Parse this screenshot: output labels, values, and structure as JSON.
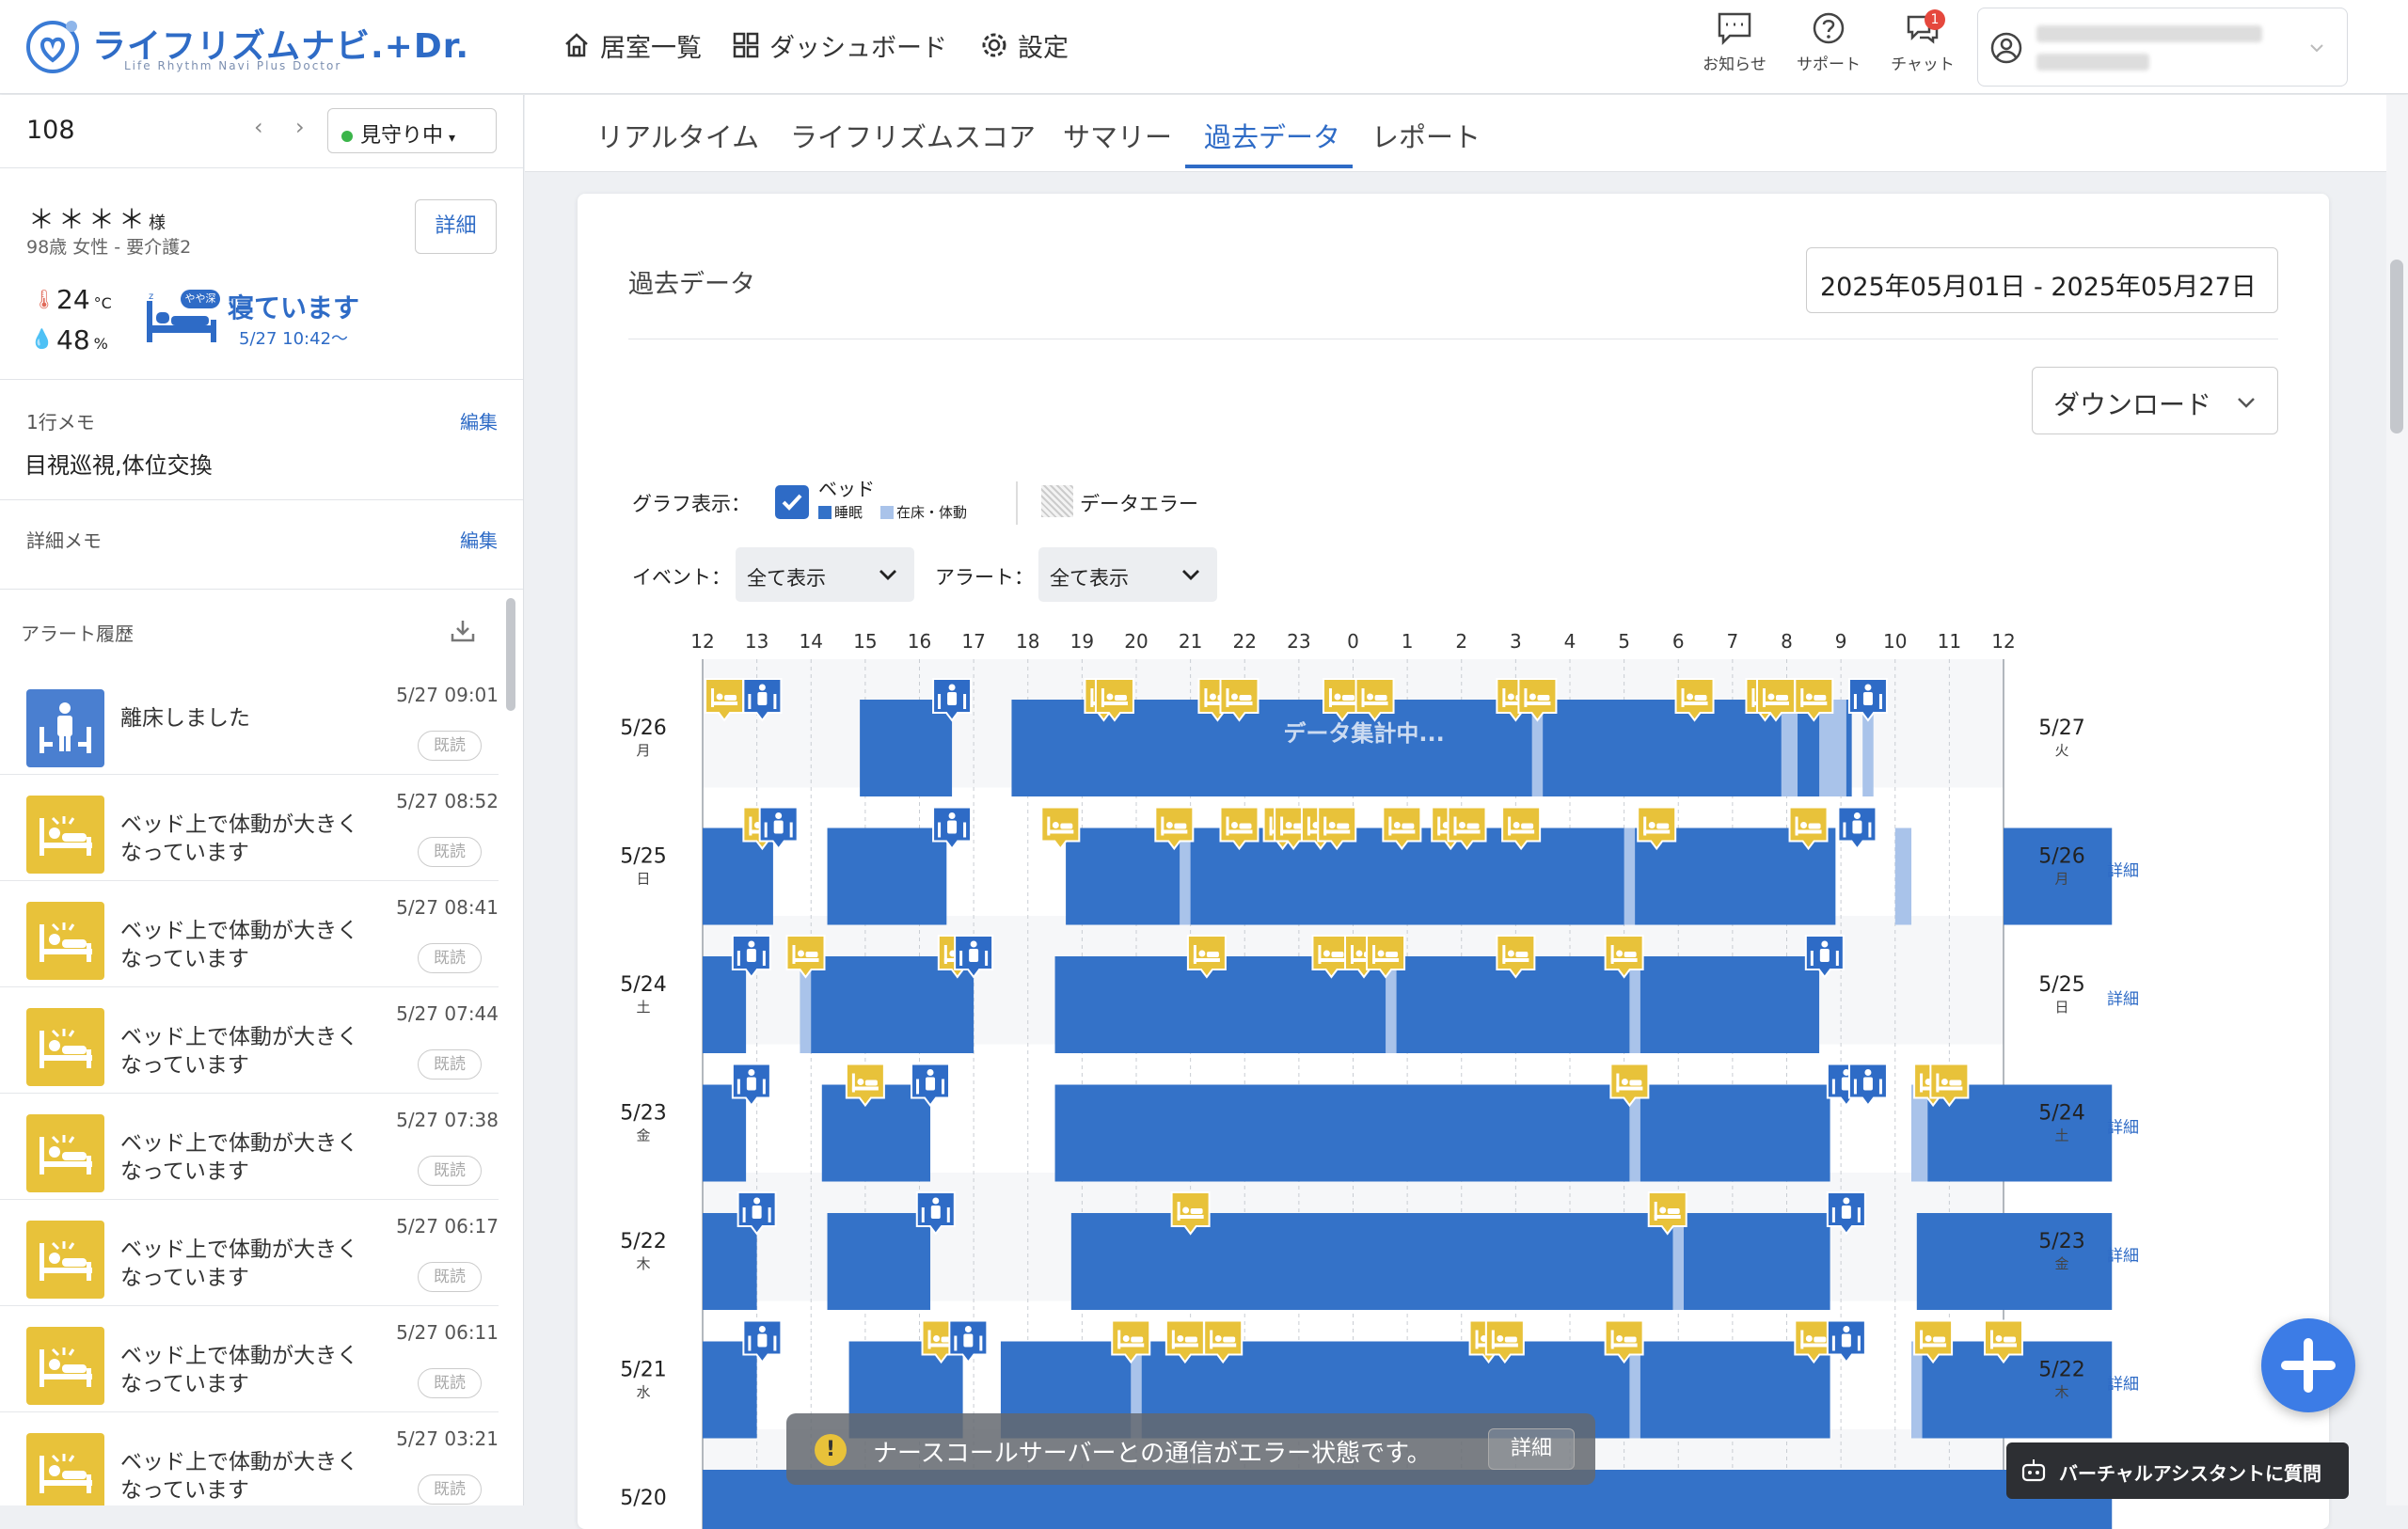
{
  "header": {
    "logo_text": "ライフリズムナビ.+Dr.",
    "logo_sub": "Life Rhythm Navi Plus Doctor",
    "nav": [
      {
        "label": "居室一覧",
        "icon": "home-icon"
      },
      {
        "label": "ダッシュボード",
        "icon": "dashboard-icon"
      },
      {
        "label": "設定",
        "icon": "gear-icon"
      }
    ],
    "icons": [
      {
        "label": "お知らせ",
        "icon": "notice-icon"
      },
      {
        "label": "サポート",
        "icon": "help-icon"
      },
      {
        "label": "チャット",
        "icon": "chat-icon",
        "badge": "1"
      }
    ]
  },
  "room": {
    "number": "108",
    "status": "見守り中",
    "name": "＊＊＊＊",
    "honorific": "様",
    "info": "98歳 女性 - 要介護2",
    "detail": "詳細",
    "temp": "24",
    "temp_unit": "°C",
    "humidity": "48",
    "humidity_unit": "%",
    "state": "寝ています",
    "state_badge": "やや深",
    "state_time": "5/27 10:42〜"
  },
  "memo": {
    "line_label": "1行メモ",
    "edit": "編集",
    "line_text": "目視巡視,体位交換",
    "detail_label": "詳細メモ"
  },
  "alerts": {
    "title": "アラート履歴",
    "read": "既読",
    "items": [
      {
        "text": "離床しました",
        "time": "5/27 09:01",
        "type": "exit"
      },
      {
        "text": "ベッド上で体動が大きくなっています",
        "time": "5/27 08:52",
        "type": "move"
      },
      {
        "text": "ベッド上で体動が大きくなっています",
        "time": "5/27 08:41",
        "type": "move"
      },
      {
        "text": "ベッド上で体動が大きくなっています",
        "time": "5/27 07:44",
        "type": "move"
      },
      {
        "text": "ベッド上で体動が大きくなっています",
        "time": "5/27 07:38",
        "type": "move"
      },
      {
        "text": "ベッド上で体動が大きくなっています",
        "time": "5/27 06:17",
        "type": "move"
      },
      {
        "text": "ベッド上で体動が大きくなっています",
        "time": "5/27 06:11",
        "type": "move"
      },
      {
        "text": "ベッド上で体動が大きくなっています",
        "time": "5/27 03:21",
        "type": "move"
      }
    ]
  },
  "tabs": [
    "リアルタイム",
    "ライフリズムスコア",
    "サマリー",
    "過去データ",
    "レポート"
  ],
  "active_tab": 3,
  "panel": {
    "title": "過去データ",
    "date_range": "2025年05月01日 - 2025年05月27日",
    "download": "ダウンロード",
    "graph_label": "グラフ表示：",
    "bed_label": "ベッド",
    "sleep_label": "睡眠",
    "inbed_label": "在床・体動",
    "error_label": "データエラー",
    "event_label": "イベント：",
    "event_value": "全て表示",
    "alert_label": "アラート：",
    "alert_value": "全て表示"
  },
  "colors": {
    "sleep": "#3472c8",
    "inbed": "#a9c3ea",
    "move_alert": "#e8c23a",
    "exit_alert": "#2e6bc6",
    "accent": "#2e6bc6"
  },
  "chart_data": {
    "type": "timeline",
    "hours": [
      "12",
      "13",
      "14",
      "15",
      "16",
      "17",
      "18",
      "19",
      "20",
      "21",
      "22",
      "23",
      "0",
      "1",
      "2",
      "3",
      "4",
      "5",
      "6",
      "7",
      "8",
      "9",
      "10",
      "11",
      "12"
    ],
    "processing_text": "データ集計中...",
    "detail_link": "詳細",
    "rows": [
      {
        "left": "5/26",
        "left_dow": "月",
        "right": "5/27",
        "right_dow": "火",
        "detail": false,
        "sleep": [
          [
            2.9,
            4.6
          ],
          [
            5.7,
            21.2
          ]
        ],
        "inbed": [
          [
            15.3,
            15.5
          ],
          [
            19.9,
            20.2
          ],
          [
            20.6,
            21.1
          ],
          [
            21.4,
            21.6
          ]
        ],
        "move": [
          0.4,
          7.4,
          7.6,
          9.5,
          9.9,
          11.8,
          12.4,
          15.0,
          15.4,
          18.3,
          19.6,
          19.8,
          20.5
        ],
        "exit": [
          1.1,
          4.6,
          21.5
        ]
      },
      {
        "left": "5/25",
        "left_dow": "日",
        "right": "5/26",
        "right_dow": "月",
        "detail": true,
        "sleep": [
          [
            0,
            1.3
          ],
          [
            2.3,
            4.5
          ],
          [
            6.7,
            20.9
          ],
          [
            24.0,
            26.0
          ]
        ],
        "inbed": [
          [
            8.8,
            9.0
          ],
          [
            17.0,
            17.2
          ],
          [
            22.0,
            22.3
          ]
        ],
        "move": [
          1.1,
          6.6,
          8.7,
          9.9,
          10.7,
          10.9,
          11.4,
          11.7,
          12.9,
          13.8,
          14.1,
          15.1,
          17.6,
          20.4
        ],
        "exit": [
          1.4,
          4.6,
          21.3
        ]
      },
      {
        "left": "5/24",
        "left_dow": "土",
        "right": "5/25",
        "right_dow": "日",
        "detail": true,
        "sleep": [
          [
            0,
            0.8
          ],
          [
            1.8,
            5.0
          ],
          [
            6.5,
            20.6
          ]
        ],
        "inbed": [
          [
            1.8,
            2.0
          ],
          [
            12.6,
            12.8
          ],
          [
            17.1,
            17.3
          ]
        ],
        "move": [
          1.9,
          4.7,
          9.3,
          11.6,
          12.2,
          12.6,
          15.0,
          17.0
        ],
        "exit": [
          0.9,
          5.0,
          20.7
        ]
      },
      {
        "left": "5/23",
        "left_dow": "金",
        "right": "5/24",
        "right_dow": "土",
        "detail": true,
        "sleep": [
          [
            0,
            0.8
          ],
          [
            2.2,
            4.2
          ],
          [
            6.5,
            20.8
          ],
          [
            22.3,
            26.0
          ]
        ],
        "inbed": [
          [
            17.1,
            17.3
          ],
          [
            22.3,
            22.6
          ]
        ],
        "move": [
          3.0,
          17.1,
          22.7,
          23.0
        ],
        "exit": [
          0.9,
          4.2,
          21.1,
          21.5
        ]
      },
      {
        "left": "5/22",
        "left_dow": "木",
        "right": "5/23",
        "right_dow": "金",
        "detail": true,
        "sleep": [
          [
            0,
            1.0
          ],
          [
            2.3,
            4.2
          ],
          [
            6.8,
            20.8
          ],
          [
            22.4,
            26.0
          ]
        ],
        "inbed": [
          [
            17.9,
            18.1
          ]
        ],
        "move": [
          9.0,
          17.8
        ],
        "exit": [
          1.0,
          4.3,
          21.1
        ]
      },
      {
        "left": "5/21",
        "left_dow": "水",
        "right": "5/22",
        "right_dow": "木",
        "detail": true,
        "sleep": [
          [
            0,
            1.0
          ],
          [
            2.7,
            4.8
          ],
          [
            5.5,
            20.8
          ],
          [
            22.3,
            26.0
          ]
        ],
        "inbed": [
          [
            7.9,
            8.1
          ],
          [
            17.1,
            17.3
          ],
          [
            22.3,
            22.5
          ]
        ],
        "move": [
          4.4,
          7.9,
          8.9,
          9.6,
          14.5,
          14.8,
          17.0,
          20.5,
          22.7,
          24.0
        ],
        "exit": [
          1.1,
          4.9,
          21.1
        ]
      }
    ]
  },
  "toast": {
    "text": "ナースコールサーバーとの通信がエラー状態です。",
    "button": "詳細"
  },
  "assistant": {
    "label": "バーチャルアシスタントに質問"
  }
}
